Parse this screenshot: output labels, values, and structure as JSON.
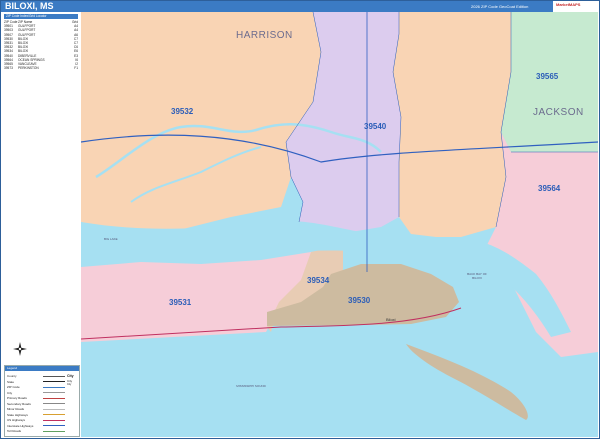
{
  "header": {
    "title": "BILOXI, MS",
    "edition": "2026 ZIP Code GeoCoat Edition",
    "logo_text": "MarketMAPS"
  },
  "sidebar": {
    "zip_list_header": "ZIP Code Index/Grid Locator",
    "zip_columns": [
      "ZIP Code",
      "ZIP Name",
      "Grid"
    ],
    "zip_rows": [
      [
        "39501",
        "GULFPORT",
        "A4"
      ],
      [
        "39503",
        "GULFPORT",
        "A4"
      ],
      [
        "39507",
        "GULFPORT",
        "A6"
      ],
      [
        "39530",
        "BILOXI",
        "C7"
      ],
      [
        "39531",
        "BILOXI",
        "C7"
      ],
      [
        "39532",
        "BILOXI",
        "C6"
      ],
      [
        "39534",
        "BILOXI",
        "E6"
      ],
      [
        "39540",
        "DIBERVILLE",
        "E3"
      ],
      [
        "39564",
        "OCEAN SPRINGS",
        "I6"
      ],
      [
        "39565",
        "VANCLEAVE",
        "I2"
      ],
      [
        "39573",
        "PERKINSTON",
        "F1"
      ]
    ],
    "legend_header": "Legend",
    "legend_items": [
      {
        "label": "County",
        "color": "#555555"
      },
      {
        "label": "State",
        "color": "#222222"
      },
      {
        "label": "ZIP Code",
        "color": "#3b7bc4"
      },
      {
        "label": "City",
        "color": "#999999"
      },
      {
        "label": "Primary Roads",
        "color": "#c04040"
      },
      {
        "label": "Secondary Roads",
        "color": "#888888"
      },
      {
        "label": "Minor Roads",
        "color": "#bbbbbb"
      },
      {
        "label": "State Highways",
        "color": "#d8a030"
      },
      {
        "label": "US Highways",
        "color": "#c03060"
      },
      {
        "label": "Interstate Highways",
        "color": "#3060c0"
      },
      {
        "label": "Toll Roads",
        "color": "#60a060"
      }
    ],
    "legend_city_sizes": [
      "City",
      "City",
      "City"
    ]
  },
  "map": {
    "county_labels": [
      "HARRISON",
      "JACKSON"
    ],
    "zip_labels": [
      "39532",
      "39540",
      "39565",
      "39564",
      "39534",
      "39531",
      "39530"
    ],
    "city_label": "Biloxi",
    "water_labels": [
      "BACK BAY OF BILOXI",
      "MISSISSIPPI SOUND",
      "BIG LAKE"
    ],
    "colors": {
      "water": "#a6e0f2",
      "zip_39532": "#f9d4b4",
      "zip_39540": "#dcccee",
      "zip_39565": "#f9d4b4",
      "zip_39565_jackson": "#c6ead0",
      "zip_39564": "#f6cdd8",
      "zip_39531": "#f6cdd8",
      "zip_39534": "#e8ccb4",
      "zip_39530": "#cdbba0",
      "zip_label": "#2b5db8",
      "interstate": "#3060c0",
      "us_highway": "#c03060"
    }
  }
}
